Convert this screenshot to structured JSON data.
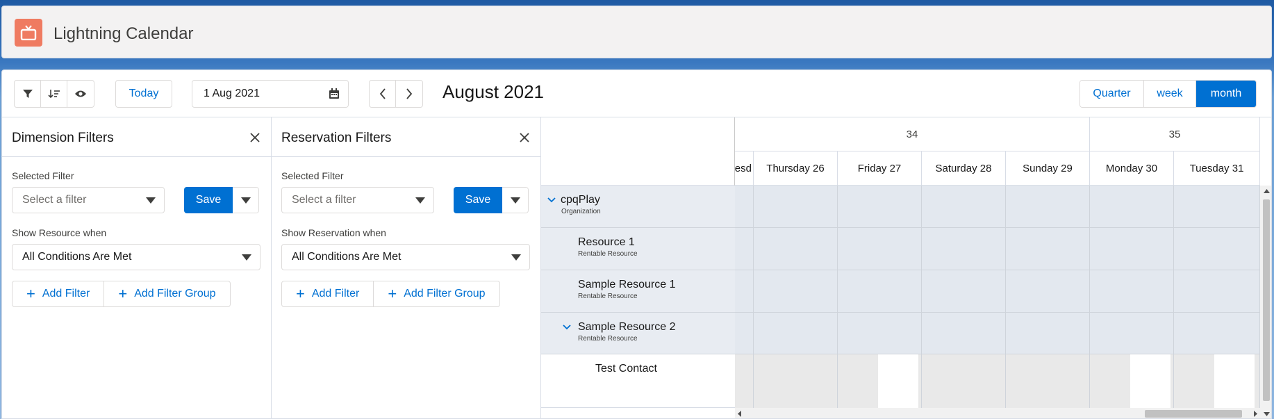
{
  "app": {
    "title": "Lightning Calendar",
    "logo_icon": "tv-icon",
    "logo_color": "#ef7b61"
  },
  "toolbar": {
    "filter_icon": "filter-icon",
    "sort_icon": "sort-icon",
    "view_icon": "eye-icon",
    "today_label": "Today",
    "date_value": "1 Aug 2021",
    "month_title": "August 2021",
    "views": [
      {
        "label": "Quarter",
        "active": false
      },
      {
        "label": "week",
        "active": false
      },
      {
        "label": "month",
        "active": true
      }
    ]
  },
  "dimension_filters": {
    "title": "Dimension Filters",
    "selected_filter_label": "Selected Filter",
    "select_placeholder": "Select a filter",
    "save_label": "Save",
    "show_when_label": "Show Resource when",
    "condition_value": "All Conditions Are Met",
    "add_filter_label": "Add Filter",
    "add_filter_group_label": "Add Filter Group"
  },
  "reservation_filters": {
    "title": "Reservation Filters",
    "selected_filter_label": "Selected Filter",
    "select_placeholder": "Select a filter",
    "save_label": "Save",
    "show_when_label": "Show Reservation when",
    "condition_value": "All Conditions Are Met",
    "add_filter_label": "Add Filter",
    "add_filter_group_label": "Add Filter Group"
  },
  "calendar": {
    "weeks": [
      "34",
      "35"
    ],
    "days": [
      "nesd",
      "Thursday 26",
      "Friday 27",
      "Saturday 28",
      "Sunday 29",
      "Monday 30",
      "Tuesday 31"
    ],
    "resources": [
      {
        "name": "cpqPlay",
        "type": "Organization",
        "expanded": true
      },
      {
        "name": "Resource 1",
        "type": "Rentable Resource"
      },
      {
        "name": "Sample Resource 1",
        "type": "Rentable Resource"
      },
      {
        "name": "Sample Resource 2",
        "type": "Rentable Resource",
        "expanded": true
      },
      {
        "name": "Test Contact",
        "type": ""
      }
    ]
  },
  "colors": {
    "brand": "#0070d2",
    "row_bg": "#e3e8ef"
  }
}
